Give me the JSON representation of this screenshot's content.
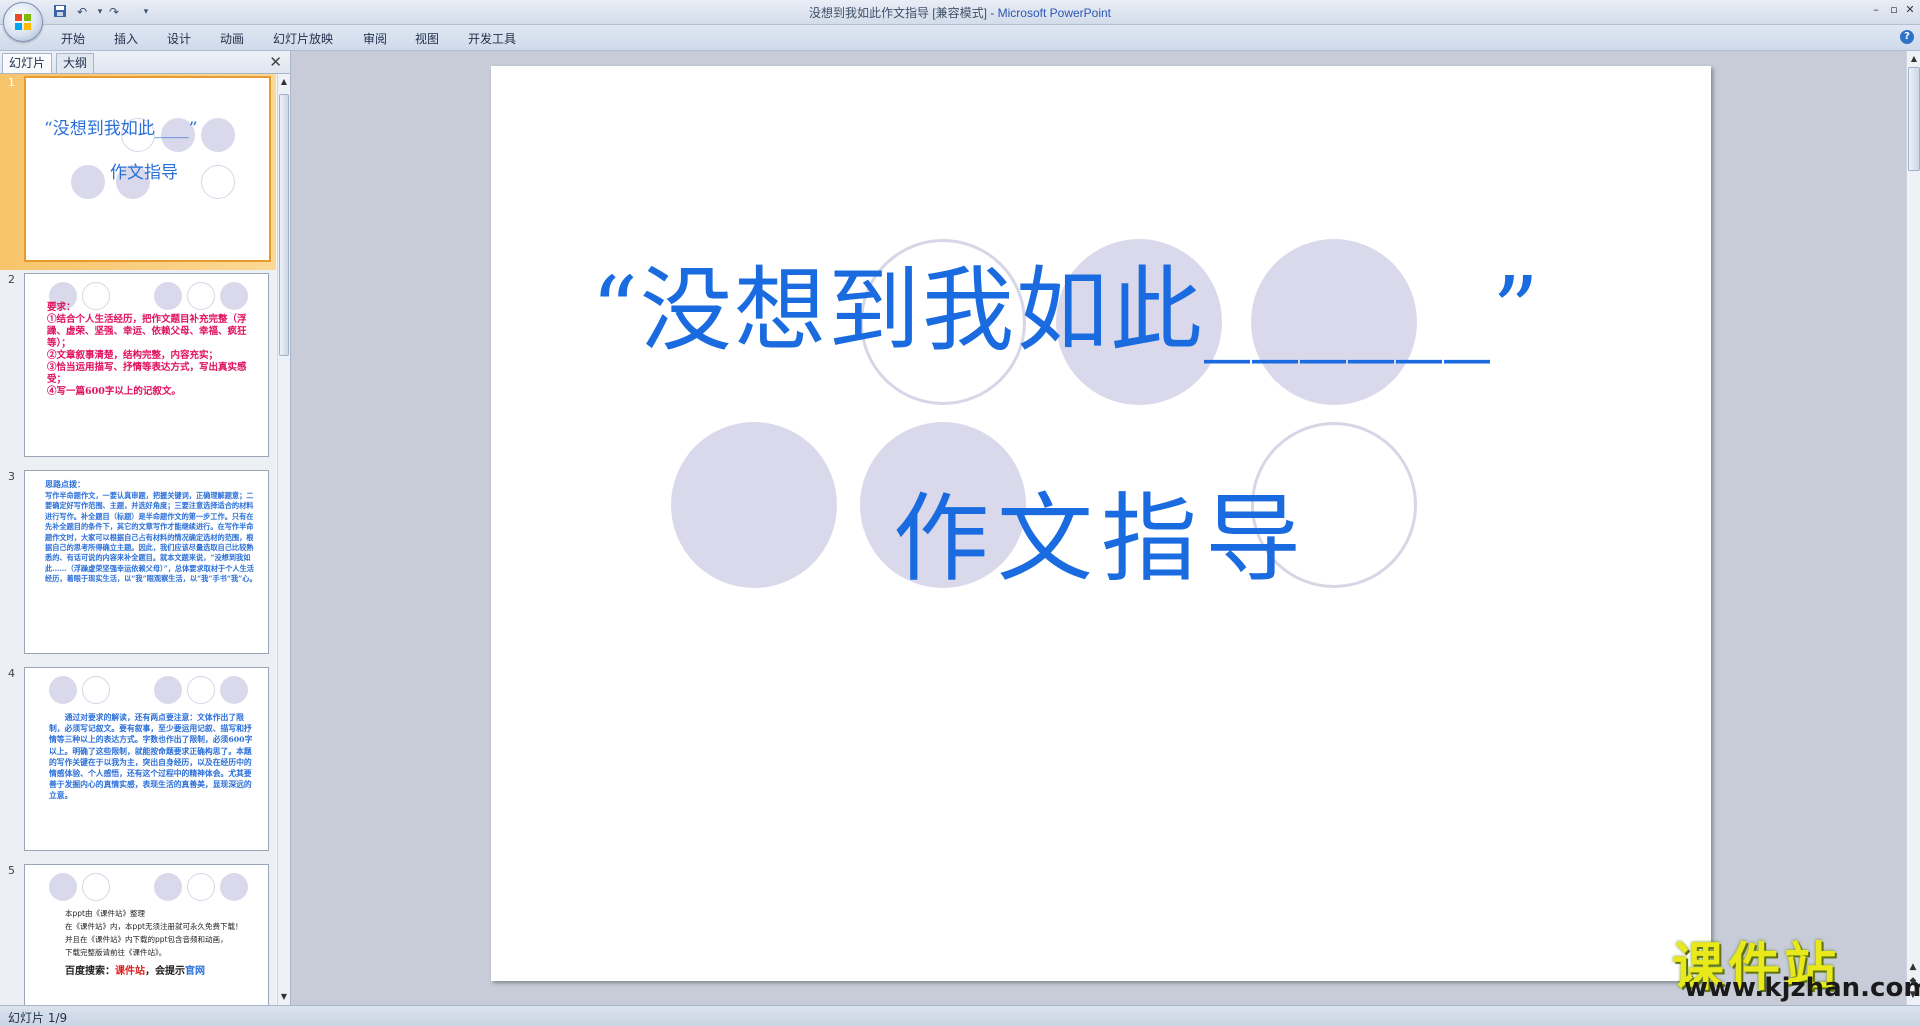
{
  "window": {
    "title": "没想到我如此作文指导 [兼容模式] - ",
    "app_name": "Microsoft PowerPoint",
    "minimize": "–",
    "maximize": "▫",
    "close": "✕"
  },
  "quick_access": {
    "save_icon": "save-icon",
    "undo_icon": "undo-icon",
    "redo_icon": "redo-icon",
    "customize_icon": "customize-icon"
  },
  "ribbon": {
    "tabs": [
      "开始",
      "插入",
      "设计",
      "动画",
      "幻灯片放映",
      "审阅",
      "视图",
      "开发工具"
    ],
    "help": "?"
  },
  "pane": {
    "tabs": [
      "幻灯片",
      "大纲"
    ],
    "close": "✕"
  },
  "thumbnails": [
    {
      "num": "1",
      "title": "“没想到我如此____”",
      "subtitle": "作文指导"
    },
    {
      "num": "2",
      "lines": [
        "要求：",
        "①结合个人生活经历，把作文题目补充完整（浮躁、虚荣、坚强、幸运、依赖父母、幸福、疯狂等）；",
        "②文章叙事清楚，结构完整，内容充实；",
        "③恰当运用描写、抒情等表达方式，写出真实感受；",
        "④写一篇600字以上的记叙文。"
      ]
    },
    {
      "num": "3",
      "heading": "思路点拨：",
      "body": "写作半命题作文，一要认真审题，把握关键词，正确理解题意；二要确定好写作范围、主题，并选好角度；三要注意选择适合的材料进行写作。补全题目（标题）是半命题作文的第一步工作。只有在先补全题目的条件下，其它的文章写作才能继续进行。在写作半命题作文时，大家可以根据自己占有材料的情况确定选材的范围，根据自己的思考所得确立主题。因此，我们应该尽量选取自己比较熟悉的、有话可说的内容来补全题目。就本文题来说，“没想到我如此……（浮躁虚荣坚强幸运依赖父母）”，总体要求取材于个人生活经历，着眼于现实生活，以“我”眼观察生活，以“我”手书“我”心。"
    },
    {
      "num": "4",
      "body": "通过对要求的解读，还有两点要注意：文体作出了限制，必须写记叙文。要有叙事，至少要运用记叙、描写和抒情等三种以上的表达方式。字数也作出了限制，必须600字以上。明确了这些限制，就能按命题要求正确构思了。本题的写作关键在于以我为主，突出自身经历，以及在经历中的情感体验、个人感悟，还有这个过程中的精神体会。尤其要善于发掘内心的真情实感，表现生活的真善美，显现深远的立意。"
    },
    {
      "num": "5",
      "lines": [
        "本ppt由《课件站》整理",
        "在《课件站》内，本ppt无须注册就可永久免费下载！",
        "并且在《课件站》内下载的ppt包含音频和动画，",
        "下载完整版请前往《课件站》。"
      ],
      "search": "百度搜索：",
      "site": "课件站",
      "tip": "，会提示",
      "official": "官网"
    }
  ],
  "slide": {
    "title": "“没想到我如此______”",
    "subtitle": "作文指导"
  },
  "status": {
    "text": "幻灯片 1/9"
  },
  "watermark": {
    "cn": "课件站",
    "url": "www.kjzhan.com"
  },
  "colors": {
    "title_blue": "#1a6be0",
    "circle_fill": "#d9d9eb",
    "thumb2_text": "#e0115f",
    "thumb_blue": "#2a6fd9",
    "selection": "#f7c46a"
  }
}
